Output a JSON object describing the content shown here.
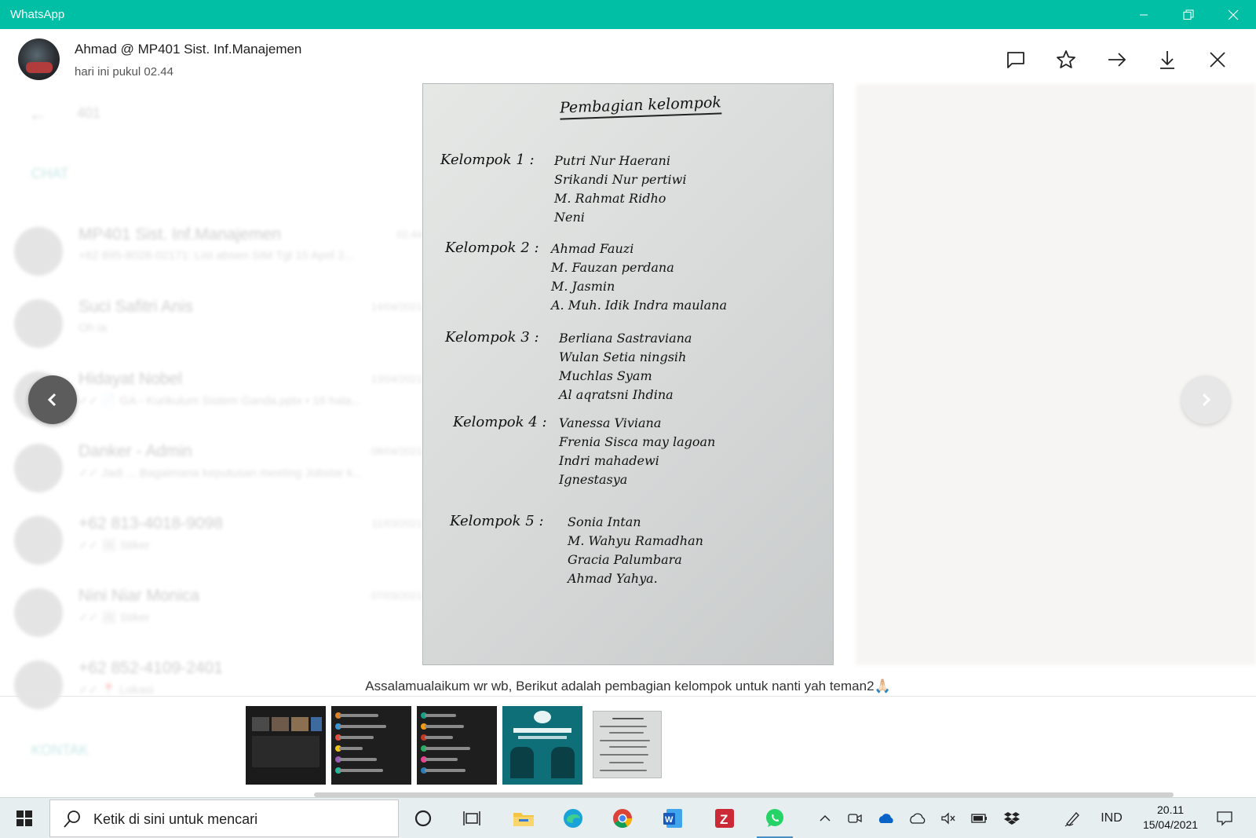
{
  "window": {
    "title": "WhatsApp"
  },
  "background": {
    "search_query": "401",
    "section_chats": "CHAT",
    "section_contacts": "KONTAK",
    "chats": [
      {
        "name": "MP401 Sist. Inf.Manajemen",
        "date": "02.44",
        "preview": "+62 895-8028-02171: List absen SIM Tgl 15 April 2..."
      },
      {
        "name": "Suci Safitri Anis",
        "date": "14/04/2021",
        "preview": "Oh ia"
      },
      {
        "name": "Hidayat Nobel",
        "date": "13/04/2021",
        "preview": "✓✓ 📄 GA - Kurikulum Sistem Ganda.pptx • 16 hala..."
      },
      {
        "name": "Danker - Admin",
        "date": "08/04/2021",
        "preview": "✓✓ Jadi ... Bagaimana keputusan meeting Jobstar k..."
      },
      {
        "name": "+62 813-4018-9098",
        "date": "11/03/2021",
        "preview": "✓✓ 🖼 Stiker"
      },
      {
        "name": "Nini Niar Monica",
        "date": "07/03/2021",
        "preview": "✓✓ 🖼 Stiker"
      },
      {
        "name": "+62 852-4109-2401",
        "date": "",
        "preview": "✓✓ 📍 Lokasi"
      }
    ]
  },
  "viewer": {
    "sender_name": "Ahmad @ MP401 Sist. Inf.Manajemen",
    "timestamp": "hari ini pukul 02.44",
    "actions": [
      "message-icon",
      "star-icon",
      "forward-icon",
      "download-icon",
      "close-icon"
    ],
    "caption": "Assalamualaikum wr wb, Berikut adalah pembagian kelompok untuk nanti yah teman2🙏🏻"
  },
  "document": {
    "title": "Pembagian kelompok",
    "groups": [
      {
        "label": "Kelompok 1 :",
        "members": [
          "Putri Nur Haerani",
          "Srikandi Nur pertiwi",
          "M. Rahmat Ridho",
          "Neni"
        ]
      },
      {
        "label": "Kelompok 2 :",
        "members": [
          "Ahmad Fauzi",
          "M. Fauzan perdana",
          "M. Jasmin",
          "A. Muh. Idik Indra maulana"
        ]
      },
      {
        "label": "Kelompok 3 :",
        "members": [
          "Berliana Sastraviana",
          "Wulan Setia ningsih",
          "Muchlas Syam",
          "Al aqratsni Ihdina"
        ]
      },
      {
        "label": "Kelompok 4 :",
        "members": [
          "Vanessa Viviana",
          "Frenia Sisca may lagoan",
          "Indri mahadewi",
          "Ignestasya"
        ]
      },
      {
        "label": "Kelompok 5 :",
        "members": [
          "Sonia Intan",
          "M. Wahyu Ramadhan",
          "Gracia Palumbara",
          "Ahmad Yahya."
        ]
      }
    ]
  },
  "thumbnails": [
    {
      "kind": "video-call-screenshot"
    },
    {
      "kind": "participants-list"
    },
    {
      "kind": "participants-list"
    },
    {
      "kind": "webinar-poster"
    },
    {
      "kind": "handwritten-list",
      "selected": true
    }
  ],
  "taskbar": {
    "search_placeholder": "Ketik di sini untuk mencari",
    "language": "IND",
    "time": "20.11",
    "date": "15/04/2021",
    "colors": {
      "accent": "#00bfa5",
      "taskbar": "#e6eef0"
    }
  }
}
